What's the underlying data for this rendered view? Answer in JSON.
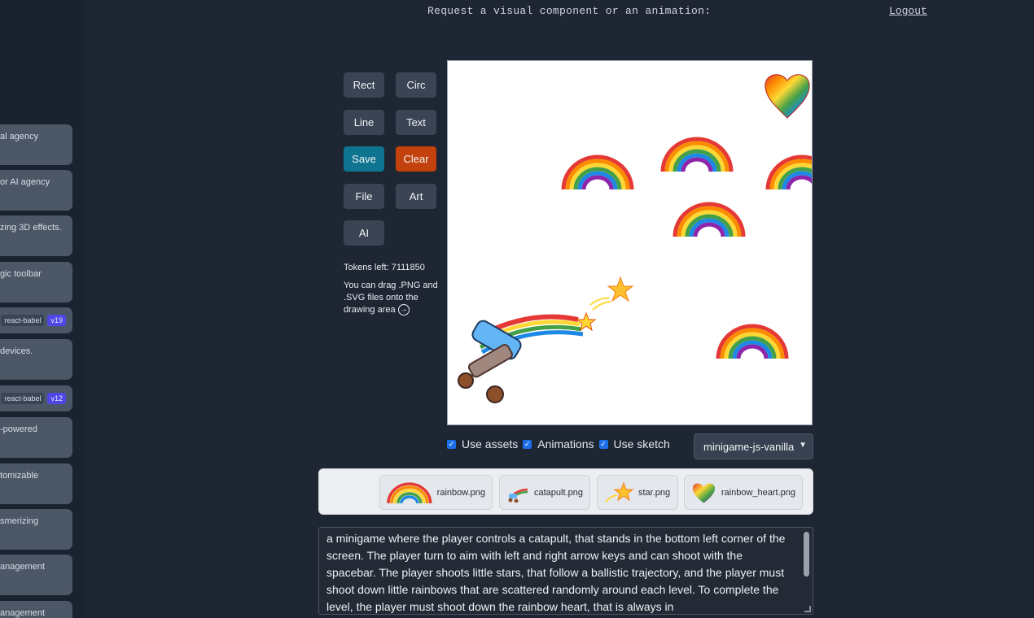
{
  "header": {
    "title": "Request a visual component or an animation:",
    "logout": "Logout"
  },
  "sidebar": {
    "items": [
      {
        "text": "al agency"
      },
      {
        "text": "or AI agency"
      },
      {
        "text": "zing 3D effects."
      },
      {
        "text": "gic toolbar"
      },
      {
        "tag": "react-babel",
        "version": "v19"
      },
      {
        "text": "devices."
      },
      {
        "tag": "react-babel",
        "version": "v12"
      },
      {
        "text": "-powered"
      },
      {
        "text": "tomizable"
      },
      {
        "text": "smerizing"
      },
      {
        "text": "anagement"
      },
      {
        "text": "anagement"
      }
    ]
  },
  "toolbar": {
    "rect": "Rect",
    "circ": "Circ",
    "line": "Line",
    "text": "Text",
    "save": "Save",
    "clear": "Clear",
    "file": "File",
    "art": "Art",
    "ai": "AI"
  },
  "tokens": "Tokens left: 7111850",
  "drag_note": "You can drag .PNG and .SVG files onto the drawing area",
  "options": {
    "use_assets": "Use assets",
    "animations": "Animations",
    "use_sketch": "Use sketch",
    "select_value": "minigame-js-vanilla"
  },
  "assets": [
    {
      "name": "rainbow.png",
      "icon": "rainbow-icon"
    },
    {
      "name": "catapult.png",
      "icon": "catapult-icon"
    },
    {
      "name": "star.png",
      "icon": "star-icon"
    },
    {
      "name": "rainbow_heart.png",
      "icon": "rainbow-heart-icon"
    }
  ],
  "prompt": "a minigame where the player controls a catapult, that stands in the bottom left corner of the screen. The player turn to aim with left and right arrow keys and can shoot with the spacebar. The player shoots little stars, that follow a ballistic trajectory, and the player must shoot down little rainbows that are scattered randomly around each level. To complete the level, the player must shoot down the rainbow heart, that is always in"
}
